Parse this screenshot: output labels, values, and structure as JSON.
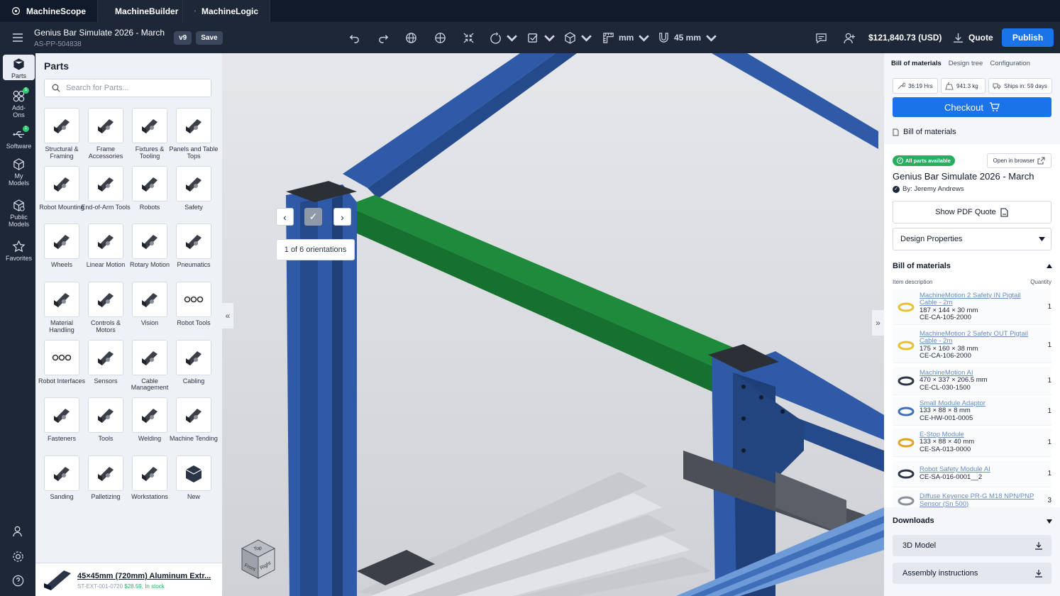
{
  "app_tabs": [
    {
      "label": "MachineScope"
    },
    {
      "label": "MachineBuilder"
    },
    {
      "label": "MachineLogic"
    }
  ],
  "project": {
    "title": "Genius Bar Simulate 2026 - March",
    "code": "AS-PP-504838",
    "version": "v9",
    "save_label": "Save"
  },
  "toolbar": {
    "unit": "mm",
    "grid": "45 mm",
    "price": "$121,840.73 (USD)",
    "quote_label": "Quote",
    "publish_label": "Publish"
  },
  "rail": {
    "items": [
      {
        "label": "Parts"
      },
      {
        "label": "Add-Ons",
        "badge": "5"
      },
      {
        "label": "Software",
        "badge": "1"
      },
      {
        "label": "My Models"
      },
      {
        "label": "Public Models"
      },
      {
        "label": "Favorites"
      }
    ]
  },
  "parts_panel": {
    "title": "Parts",
    "search_placeholder": "Search for Parts...",
    "categories": [
      "Structural & Framing",
      "Frame Accessories",
      "Fixtures & Tooling",
      "Panels and Table Tops",
      "Robot Mounting",
      "End-of-Arm Tools",
      "Robots",
      "Safety",
      "Wheels",
      "Linear Motion",
      "Rotary Motion",
      "Pneumatics",
      "Material Handling",
      "Controls & Motors",
      "Vision",
      "Robot Tools",
      "Robot Interfaces",
      "Sensors",
      "Cable Management",
      "Cabling",
      "Fasteners",
      "Tools",
      "Welding",
      "Machine Tending",
      "Sanding",
      "Palletizing",
      "Workstations",
      "New"
    ],
    "selected_part": {
      "name": "45×45mm (720mm) Aluminum Extr...",
      "sku": "ST-EXT-001-0720",
      "price": "$28.59, In stock"
    }
  },
  "viewport": {
    "orientation_label": "1 of 6 orientations",
    "cube_faces": [
      "Top",
      "Front",
      "Right"
    ]
  },
  "right_panel": {
    "tabs": [
      "Bill of materials",
      "Design tree",
      "Configuration"
    ],
    "stats": {
      "hours": "36:19 Hrs",
      "weight": "941.3 kg",
      "ships": "Ships in: 59 days"
    },
    "checkout_label": "Checkout",
    "section_label": "Bill of materials",
    "availability": "All parts available",
    "open_browser": "Open in browser",
    "card_title": "Genius Bar Simulate 2026 - March",
    "author": "By: Jeremy Andrews",
    "pdf_quote": "Show PDF Quote",
    "design_properties": "Design Properties",
    "bom": {
      "title": "Bill of materials",
      "col_desc": "Item description",
      "col_qty": "Quantity",
      "items": [
        {
          "name": "MachineMotion 2 Safety IN Pigtail Cable - 2m",
          "dims": "187 × 144 × 30 mm",
          "sku": "CE-CA-105-2000",
          "qty": "1"
        },
        {
          "name": "MachineMotion 2 Safety OUT Pigtail Cable - 2m",
          "dims": "175 × 160 × 38 mm",
          "sku": "CE-CA-106-2000",
          "qty": "1"
        },
        {
          "name": "MachineMotion AI",
          "dims": "470 × 337 × 206.5 mm",
          "sku": "CE-CL-030-1500",
          "qty": "1"
        },
        {
          "name": "Small Module Adaptor",
          "dims": "133 × 88 × 8 mm",
          "sku": "CE-HW-001-0005",
          "qty": "1"
        },
        {
          "name": "E-Stop Module",
          "dims": "133 × 88 × 40 mm",
          "sku": "CE-SA-013-0000",
          "qty": "1"
        },
        {
          "name": "Robot Safety Module AI",
          "dims": "",
          "sku": "CE-SA-016-0001__2",
          "qty": "1"
        },
        {
          "name": "Diffuse Keyence PR-G M18 NPN/PNP Sensor (Sn 500)",
          "dims": "",
          "sku": "",
          "qty": "3"
        }
      ]
    },
    "downloads": {
      "title": "Downloads",
      "items": [
        "3D Model",
        "Assembly instructions"
      ]
    }
  },
  "colors": {
    "accent": "#1a73e8",
    "dark": "#1d2738",
    "frame_blue": "#2f5aa8",
    "green_beam": "#1e8a3c",
    "success": "#27ae60"
  }
}
